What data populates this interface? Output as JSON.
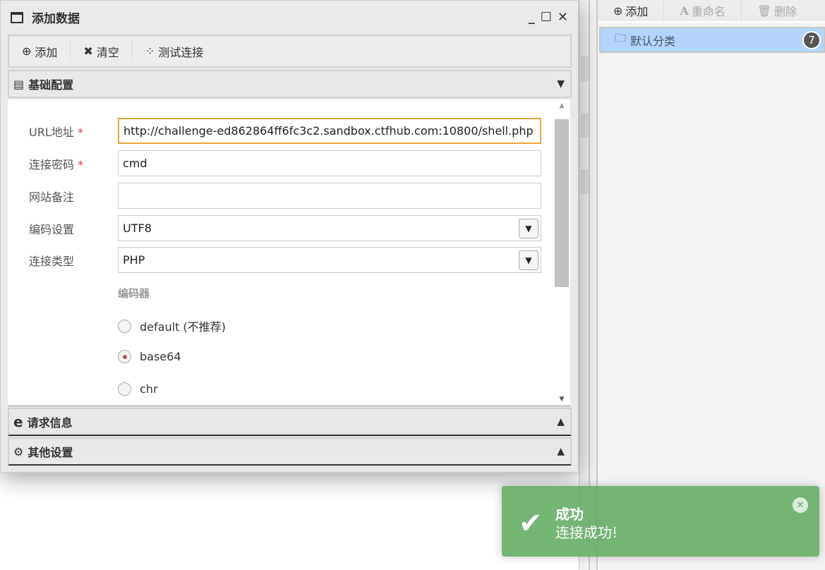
{
  "dialog": {
    "title": "添加数据",
    "toolbar": {
      "add": "添加",
      "clear": "清空",
      "test": "测试连接"
    },
    "sections": {
      "basic": "基础配置",
      "request": "请求信息",
      "other": "其他设置"
    },
    "form": {
      "url": {
        "label": "URL地址",
        "value": "http://challenge-ed862864ff6fc3c2.sandbox.ctfhub.com:10800/shell.php"
      },
      "password": {
        "label": "连接密码",
        "value": "cmd"
      },
      "note": {
        "label": "网站备注",
        "value": ""
      },
      "encoding": {
        "label": "编码设置",
        "value": "UTF8"
      },
      "type": {
        "label": "连接类型",
        "value": "PHP"
      },
      "encoder": {
        "label": "编码器",
        "options": [
          "default (不推荐)",
          "base64",
          "chr"
        ],
        "selected": "base64"
      },
      "required_mark": "*"
    }
  },
  "right": {
    "toolbar": {
      "add": "添加",
      "rename": "重命名",
      "delete": "删除"
    },
    "items": [
      {
        "label": "默认分类",
        "count": "7"
      }
    ]
  },
  "toast": {
    "title": "成功",
    "message": "连接成功!",
    "color": "#72b372"
  }
}
